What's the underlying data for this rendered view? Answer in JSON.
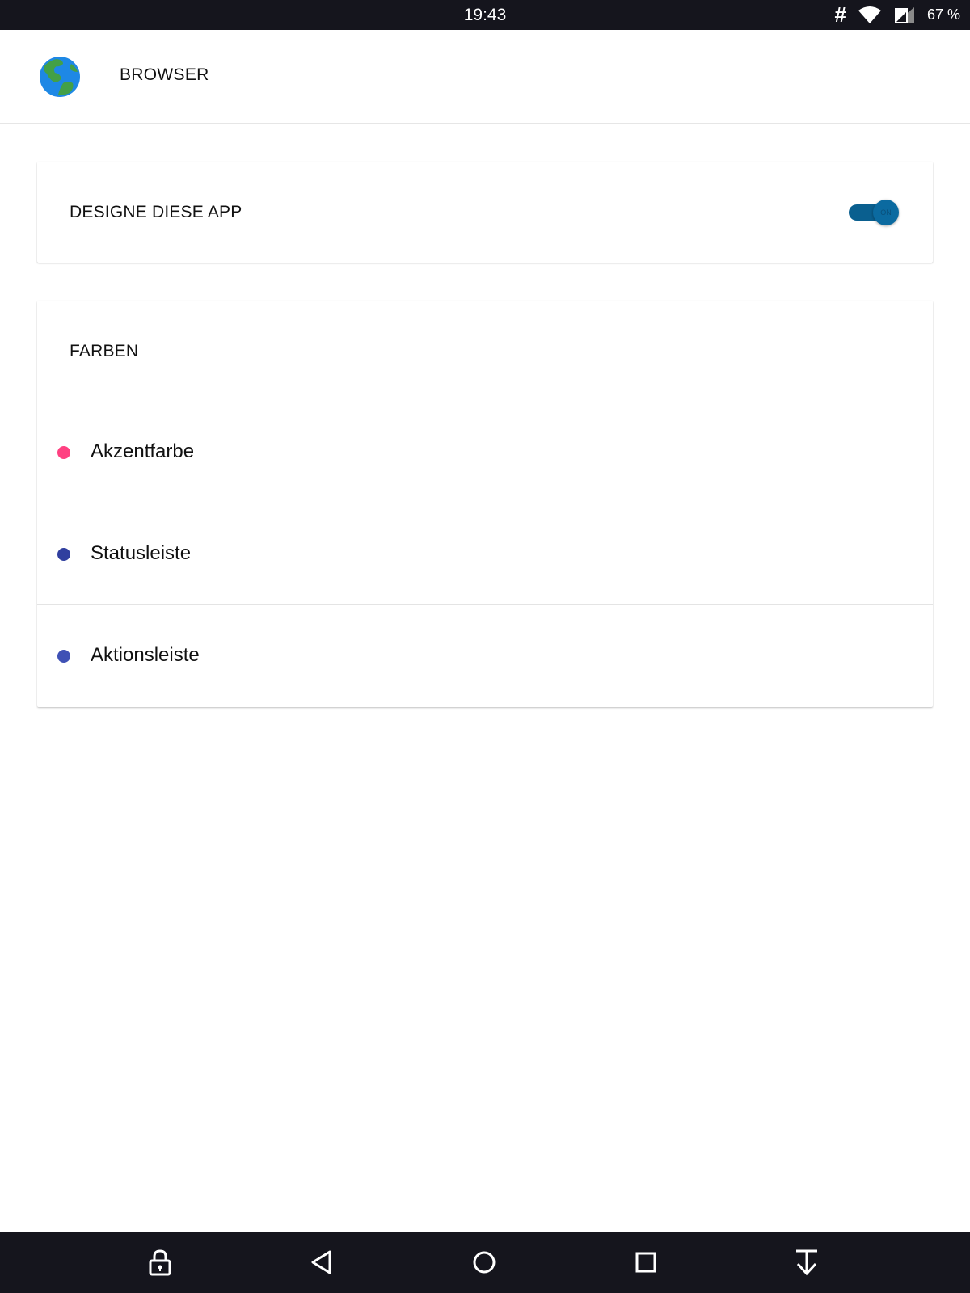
{
  "status_bar": {
    "time": "19:43",
    "battery": "67 %",
    "icons": [
      "hash-icon",
      "wifi-icon",
      "signal-icon",
      "battery-icon"
    ]
  },
  "app_bar": {
    "title": "BROWSER",
    "icon": "globe-icon"
  },
  "theme_card": {
    "label": "DESIGNE DIESE APP",
    "toggle_state": "ON",
    "toggle_on": true,
    "toggle_color": "#0a5f8f"
  },
  "colors_card": {
    "title": "FARBEN",
    "items": [
      {
        "label": "Akzentfarbe",
        "color": "#ff4081"
      },
      {
        "label": "Statusleiste",
        "color": "#303f9f"
      },
      {
        "label": "Aktionsleiste",
        "color": "#3f51b5"
      }
    ]
  },
  "nav_bar": {
    "buttons": [
      "lock-icon",
      "back-icon",
      "home-icon",
      "recents-icon",
      "download-icon"
    ]
  }
}
